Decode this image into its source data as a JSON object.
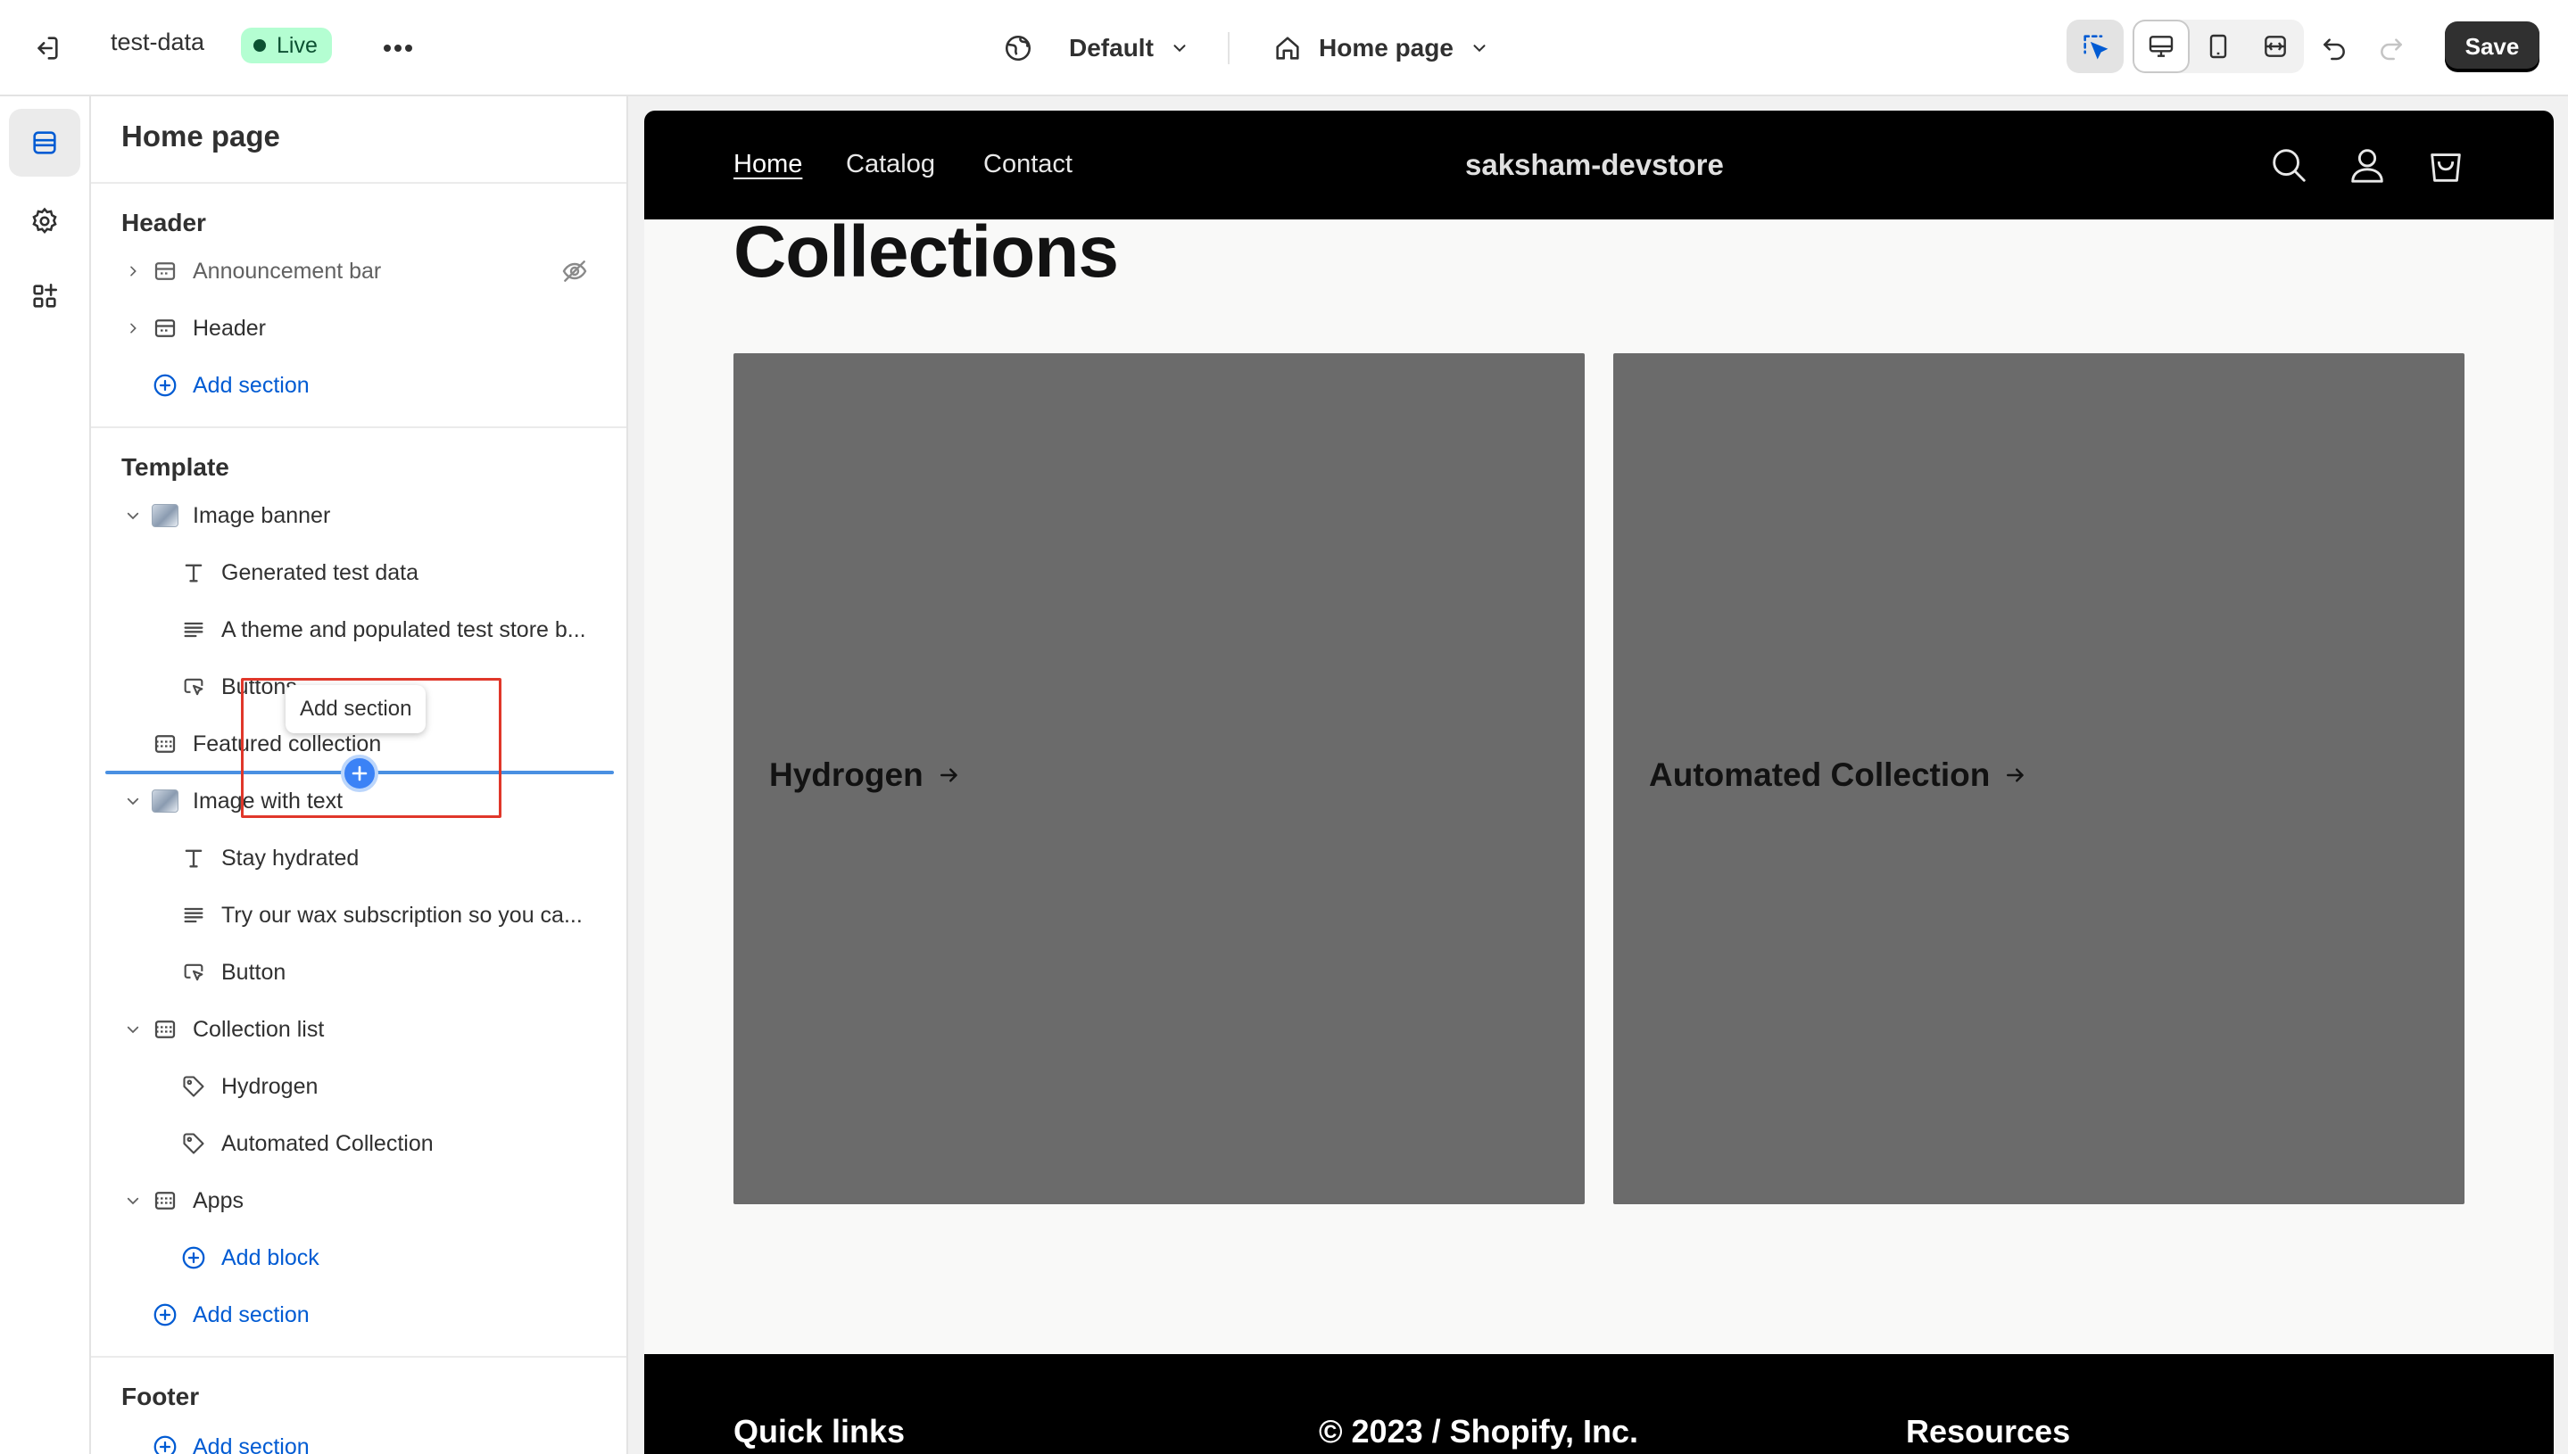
{
  "topbar": {
    "store_name": "test-data",
    "status_badge": "Live",
    "theme_label": "Default",
    "page_label": "Home page",
    "save_label": "Save"
  },
  "sidebar": {
    "title": "Home page",
    "groups": {
      "header": "Header",
      "template": "Template",
      "footer": "Footer"
    },
    "items": {
      "announcement_bar": "Announcement bar",
      "header": "Header",
      "add_section_header": "Add section",
      "image_banner": "Image banner",
      "generated_test_data": "Generated test data",
      "theme_text": "A theme and populated test store b...",
      "buttons": "Buttons",
      "featured_collection": "Featured collection",
      "image_with_text": "Image with text",
      "stay_hydrated": "Stay hydrated",
      "wax_text": "Try our wax subscription so you ca...",
      "button": "Button",
      "collection_list": "Collection list",
      "hydrogen": "Hydrogen",
      "automated_collection": "Automated Collection",
      "apps": "Apps",
      "add_block": "Add block",
      "add_section_template": "Add section",
      "add_section_footer": "Add section"
    },
    "tooltip": "Add section"
  },
  "preview": {
    "nav": [
      "Home",
      "Catalog",
      "Contact"
    ],
    "store_logo": "saksham-devstore",
    "heading": "Collections",
    "collections": [
      "Hydrogen",
      "Automated Collection"
    ],
    "footer_headings": [
      "Quick links",
      "© 2023 / Shopify, Inc.",
      "Resources"
    ]
  },
  "colors": {
    "accent": "#005bd3",
    "live_badge_bg": "#b4fed2",
    "card_bg": "#6b6b6b",
    "highlight": "#e0372a"
  }
}
